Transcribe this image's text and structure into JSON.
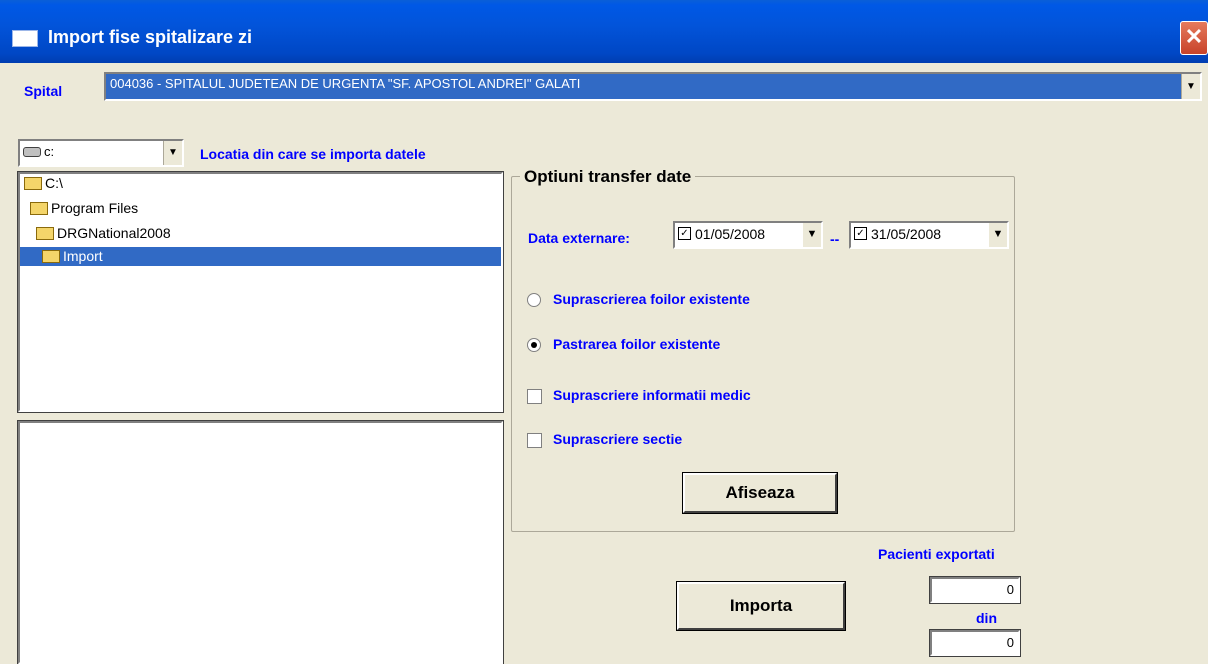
{
  "window": {
    "title": "Import fise spitalizare zi",
    "close_glyph": "✕"
  },
  "hospital": {
    "label": "Spital",
    "selected": "004036 - SPITALUL JUDETEAN DE URGENTA \"SF. APOSTOL ANDREI\" GALATI"
  },
  "drive": {
    "selected": "c:",
    "location_label": "Locatia din care se importa datele"
  },
  "tree": {
    "items": [
      "C:\\",
      "Program Files",
      "DRGNational2008",
      "Import"
    ],
    "selected_index": 3
  },
  "options": {
    "title": "Optiuni transfer date",
    "date_label": "Data externare:",
    "date_from": "01/05/2008",
    "date_to": "31/05/2008",
    "date_separator": "--",
    "radio_overwrite": "Suprascrierea foilor existente",
    "radio_keep": "Pastrarea foilor existente",
    "chk_medic": "Suprascriere informatii medic",
    "chk_sectie": "Suprascriere sectie",
    "show_button": "Afiseaza",
    "selected_radio": "keep"
  },
  "import": {
    "button": "Importa",
    "exported_label": "Pacienti exportati",
    "exported_value": "0",
    "of_label": "din",
    "total_value": "0"
  }
}
